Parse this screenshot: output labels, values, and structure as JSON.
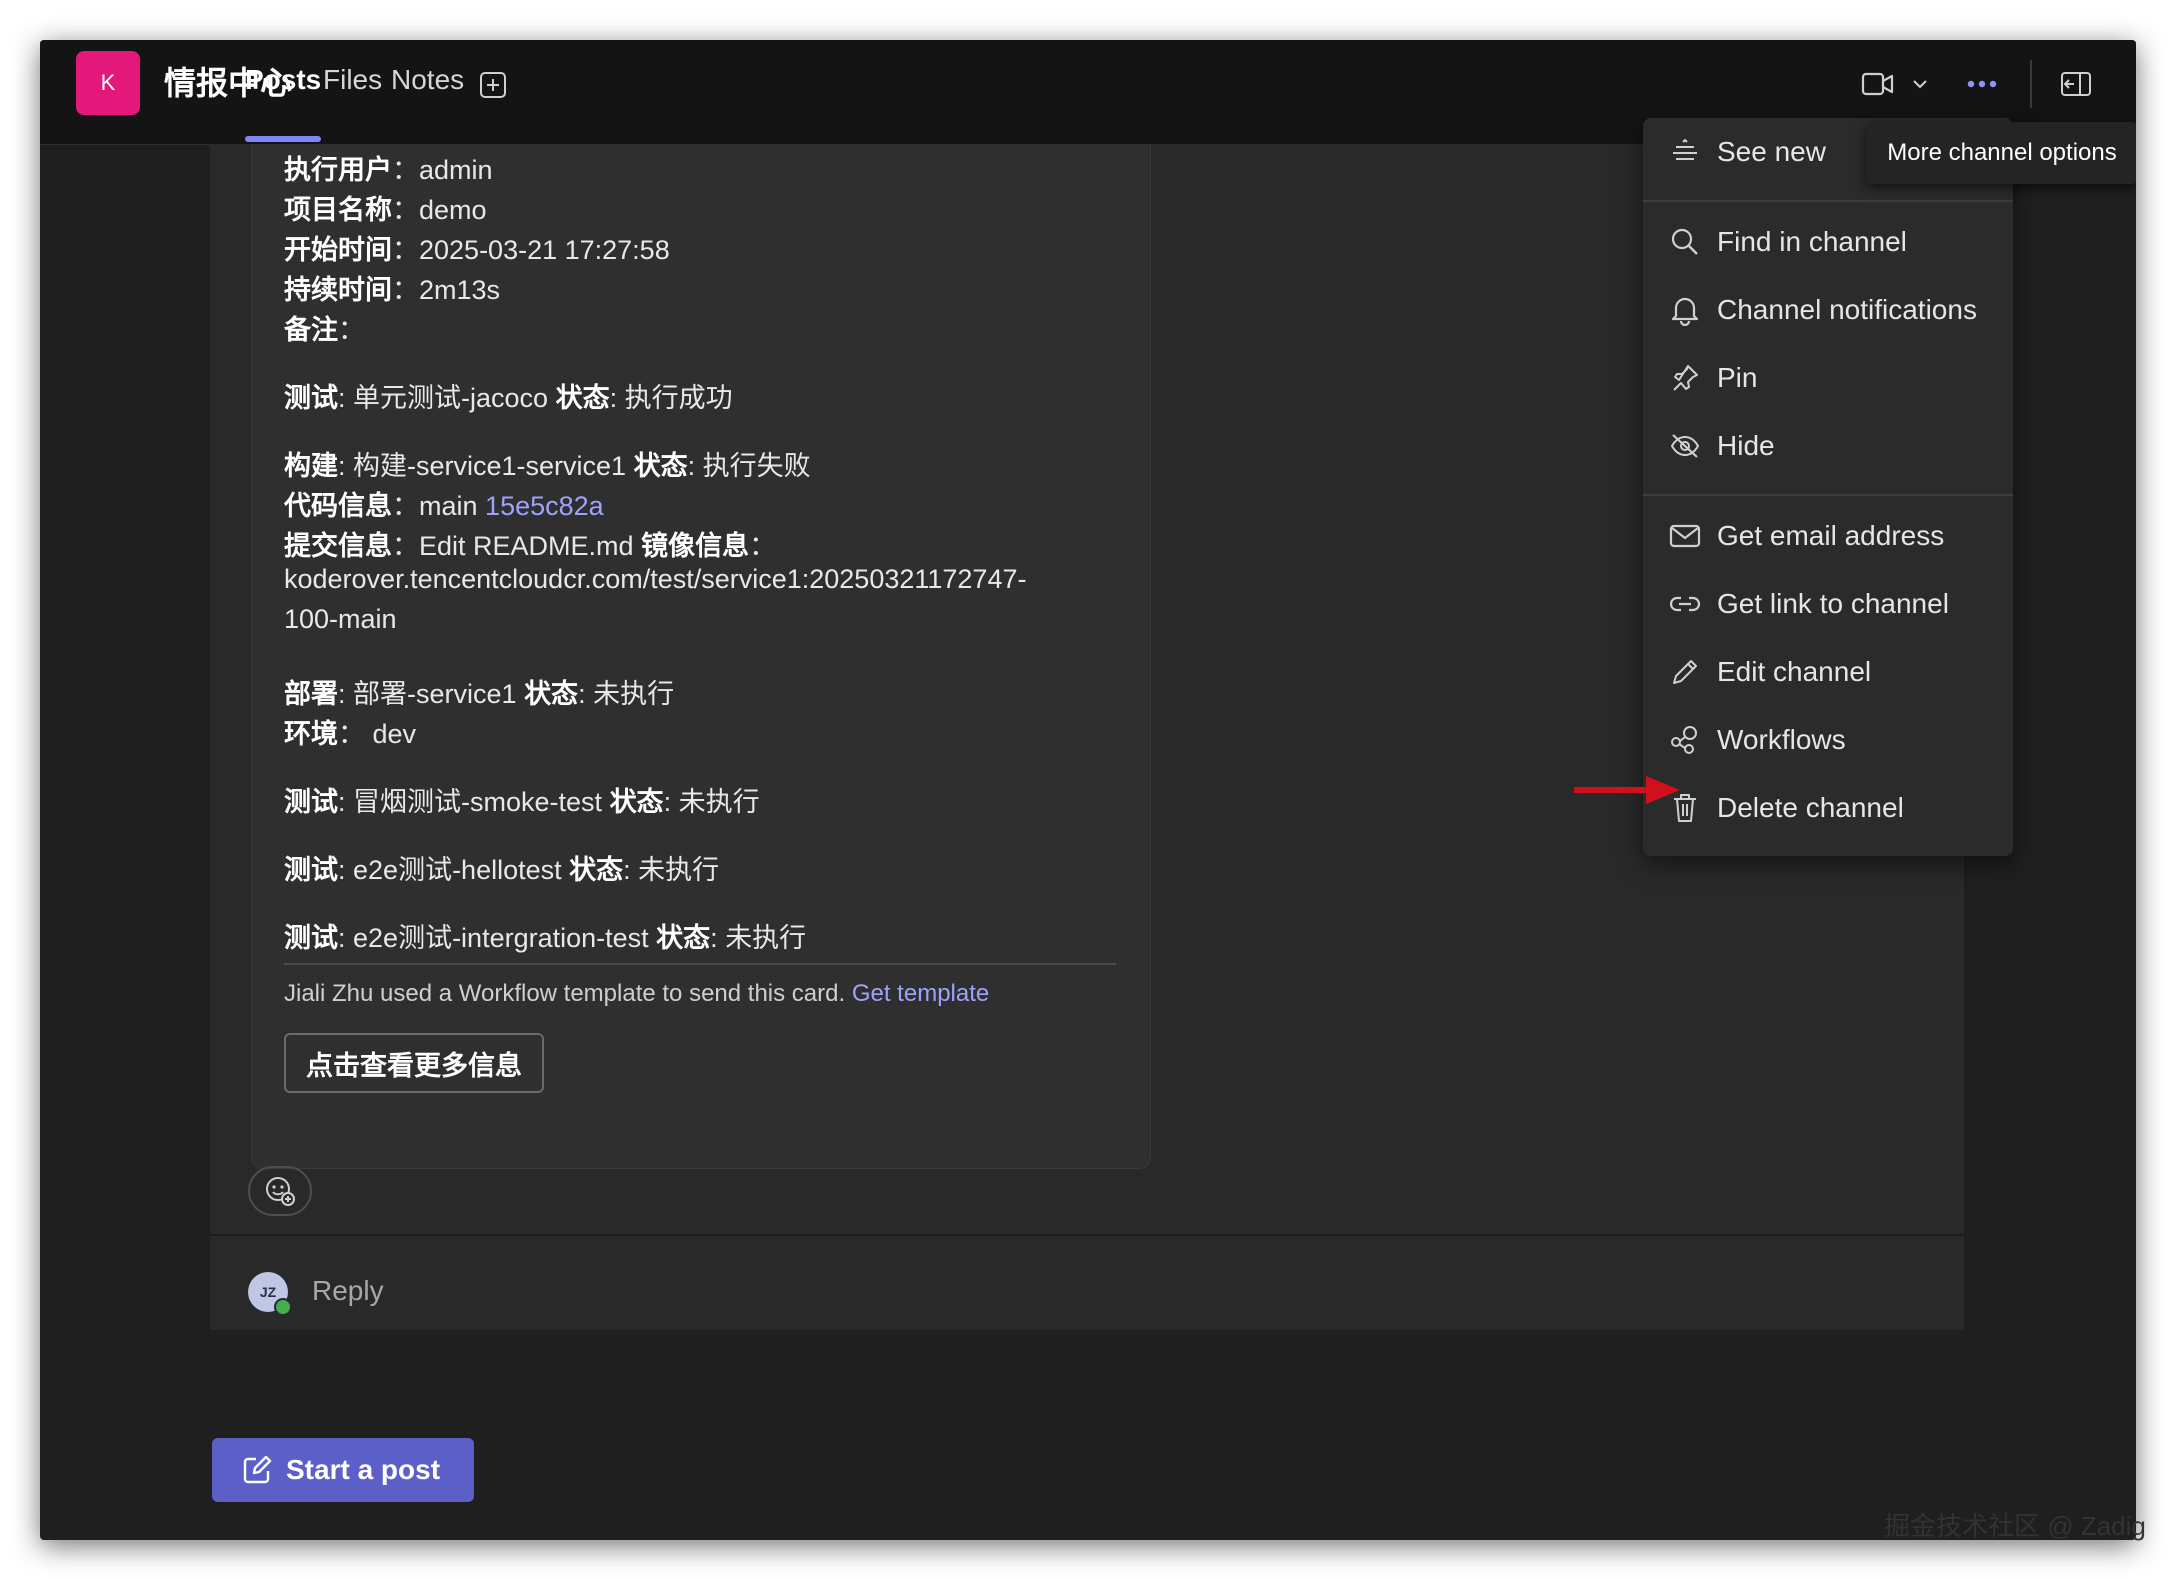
{
  "app": {
    "team_initial": "K",
    "channel_name": "情报中心",
    "tabs": [
      "Posts",
      "Files",
      "Notes"
    ],
    "accent_color": "#5b5fc7",
    "team_color": "#e3187a"
  },
  "card": {
    "lines": {
      "user_label": "执行用户",
      "user_value": "admin",
      "project_label": "项目名称",
      "project_value": "demo",
      "start_label": "开始时间",
      "start_value": "2025-03-21 17:27:58",
      "duration_label": "持续时间",
      "duration_value": "2m13s",
      "note_label": "备注"
    },
    "test1": {
      "label": "测试",
      "name": "单元测试-jacoco",
      "status_label": "状态",
      "status": "执行成功"
    },
    "build": {
      "label": "构建",
      "name": "构建-service1-service1",
      "status_label": "状态",
      "status": "执行失败"
    },
    "code": {
      "label": "代码信息",
      "branch": "main",
      "commit": "15e5c82a"
    },
    "commit_msg": {
      "label": "提交信息",
      "value": "Edit README.md",
      "image_label": "镜像信息"
    },
    "image_line1": "koderover.tencentcloudcr.com/test/service1:20250321172747-",
    "image_line2": "100-main",
    "deploy": {
      "label": "部署",
      "name": "部署-service1",
      "status_label": "状态",
      "status": "未执行"
    },
    "env": {
      "label": "环境",
      "value": "dev"
    },
    "test2": {
      "label": "测试",
      "name": "冒烟测试-smoke-test",
      "status_label": "状态",
      "status": "未执行"
    },
    "test3": {
      "label": "测试",
      "name": "e2e测试-hellotest",
      "status_label": "状态",
      "status": "未执行"
    },
    "test4": {
      "label": "测试",
      "name": "e2e测试-intergration-test",
      "status_label": "状态",
      "status": "未执行"
    },
    "footer_note": "Jiali Zhu used a Workflow template to send this card.",
    "footer_link": "Get template",
    "more_button": "点击查看更多信息"
  },
  "reply": {
    "avatar_initials": "JZ",
    "placeholder": "Reply"
  },
  "start_post": "Start a post",
  "menu": {
    "items": [
      {
        "label": "See new",
        "icon": "sort-icon"
      },
      {
        "label": "Find in channel",
        "icon": "search-icon"
      },
      {
        "label": "Channel notifications",
        "icon": "bell-icon"
      },
      {
        "label": "Pin",
        "icon": "pin-icon"
      },
      {
        "label": "Hide",
        "icon": "eye-off-icon"
      },
      {
        "label": "Get email address",
        "icon": "mail-icon"
      },
      {
        "label": "Get link to channel",
        "icon": "link-icon"
      },
      {
        "label": "Edit channel",
        "icon": "pencil-icon"
      },
      {
        "label": "Workflows",
        "icon": "workflow-icon"
      },
      {
        "label": "Delete channel",
        "icon": "trash-icon"
      }
    ],
    "tooltip": "More channel options"
  },
  "watermark": "掘金技术社区 @ Zadig"
}
